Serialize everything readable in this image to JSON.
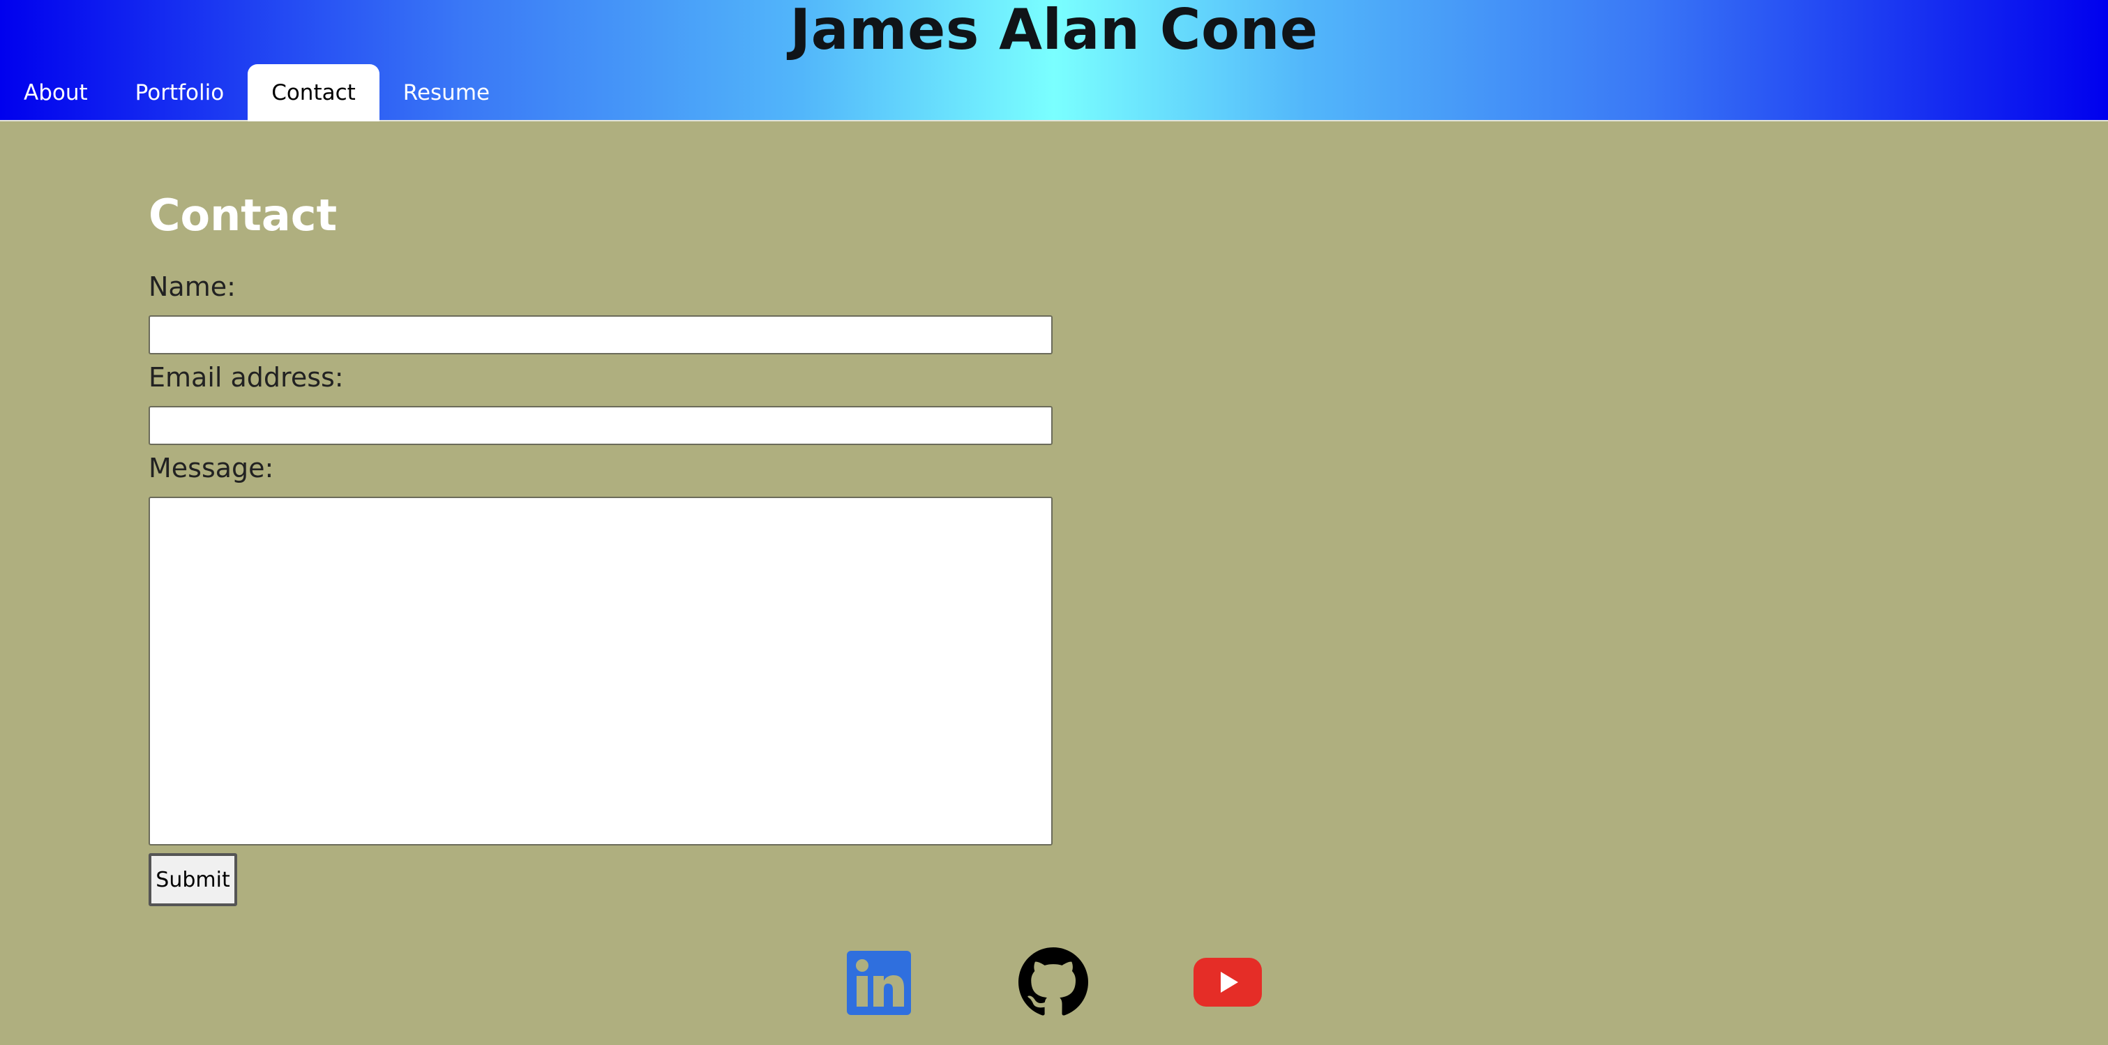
{
  "header": {
    "title": "James Alan Cone"
  },
  "nav": {
    "tabs": [
      {
        "label": "About",
        "active": false
      },
      {
        "label": "Portfolio",
        "active": false
      },
      {
        "label": "Contact",
        "active": true
      },
      {
        "label": "Resume",
        "active": false
      }
    ]
  },
  "contact": {
    "heading": "Contact",
    "name_label": "Name:",
    "name_value": "",
    "email_label": "Email address:",
    "email_value": "",
    "message_label": "Message:",
    "message_value": "",
    "submit_label": "Submit"
  },
  "social": {
    "icons": [
      "linkedin-icon",
      "github-icon",
      "youtube-icon"
    ]
  },
  "colors": {
    "page_background": "#afaf7f",
    "header_gradient_edge": "#0000ee",
    "header_gradient_center": "#7affff",
    "linkedin": "#2f6fde",
    "youtube": "#e52d27"
  }
}
